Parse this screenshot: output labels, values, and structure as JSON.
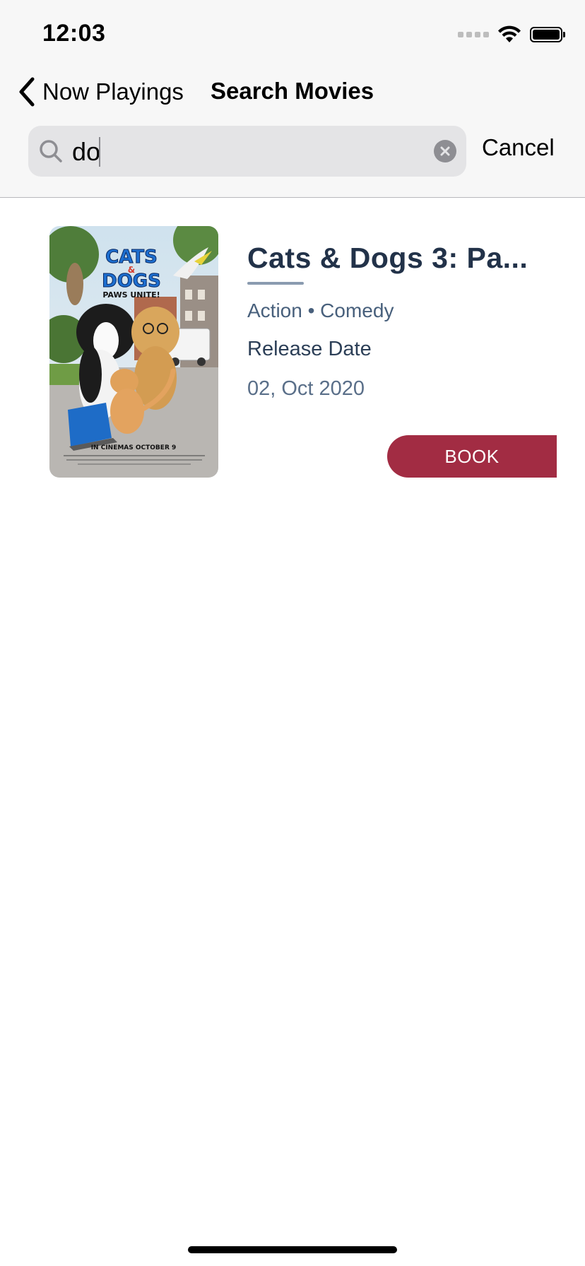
{
  "status_bar": {
    "time": "12:03"
  },
  "nav": {
    "back_label": "Now Playings",
    "title": "Search Movies"
  },
  "search": {
    "value": "do",
    "cancel_label": "Cancel"
  },
  "results": [
    {
      "title": "Cats & Dogs 3: Pa...",
      "genres": "Action • Comedy",
      "release_label": "Release Date",
      "release_date": "02, Oct 2020",
      "book_label": "BOOK",
      "poster": {
        "title_line1": "CATS",
        "title_amp": "&",
        "title_line2": "DOGS",
        "tagline": "PAWS UNITE!",
        "footer": "IN CINEMAS OCTOBER 9"
      }
    }
  ],
  "colors": {
    "accent": "#a22c43",
    "title": "#223249",
    "subtitle": "#48607c"
  }
}
